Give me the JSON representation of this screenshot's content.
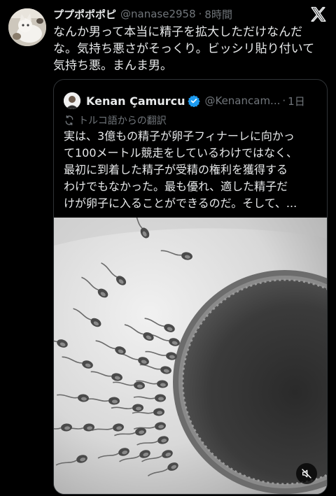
{
  "tweet": {
    "display_name": "ププポポポピ",
    "handle": "@nanase2958",
    "separator": "·",
    "time": "8時間",
    "text": "なんか男って本当に精子を拡大しただけなんだ\nな。気持ち悪さがそっくり。ビッシリ貼り付いて\n気持ち悪。まんま男。"
  },
  "quoted_tweet": {
    "display_name": "Kenan Çamurcu",
    "handle": "@Kenancam...",
    "separator": "·",
    "time": "1日",
    "translated_label": "トルコ語からの翻訳",
    "text": "実は、3億もの精子が卵子フィナーレに向かっ\nて100メートル競走をしているわけではなく、\n最初に到着した精子が受精の権利を獲得する\nわけでもなかった。最も優れ、適した精子だ\nけが卵子に入ることができるのだ。そして、..."
  },
  "icons": {
    "logo": "x-logo-icon",
    "verified": "verified-badge-icon",
    "translate": "translate-icon",
    "mute": "muted-speaker-icon"
  },
  "colors": {
    "background": "#000000",
    "text": "#e7e9ea",
    "secondary": "#71767b",
    "border": "#2f3336",
    "verified": "#1d9bf0"
  }
}
